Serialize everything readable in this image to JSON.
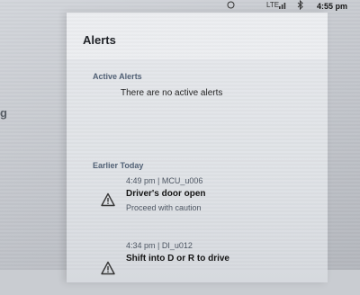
{
  "status_bar": {
    "network": "LTE",
    "time": "4:55 pm",
    "icons": [
      "circle-icon",
      "signal-icon",
      "bluetooth-icon"
    ]
  },
  "backdrop": {
    "partial_text": "g"
  },
  "panel": {
    "title": "Alerts",
    "active_section_label": "Active Alerts",
    "active_empty_message": "There are no active alerts",
    "earlier_section_label": "Earlier Today",
    "alerts": [
      {
        "time_source": "4:49 pm | MCU_u006",
        "title": "Driver's door open",
        "subtitle": "Proceed with caution",
        "icon": "warning-icon"
      },
      {
        "time_source": "4:34 pm | DI_u012",
        "title": "Shift into D or R to drive",
        "subtitle": "",
        "icon": "warning-icon"
      }
    ]
  }
}
